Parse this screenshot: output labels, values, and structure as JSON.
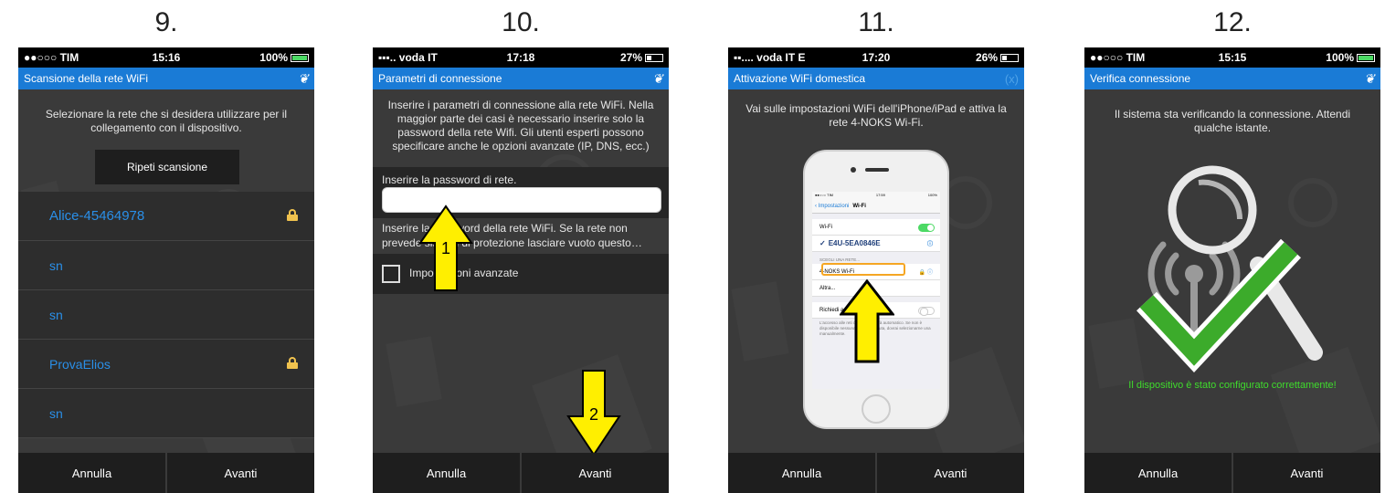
{
  "steps": [
    {
      "number": "9.",
      "status": {
        "carrier": "●●○○○ TIM",
        "time": "15:16",
        "battery": "100%"
      },
      "title": "Scansione della rete WiFi",
      "description": "Selezionare la rete che si desidera utilizzare per il collegamento con il dispositivo.",
      "scan_button": "Ripeti scansione",
      "networks": [
        {
          "ssid": "Alice-45464978",
          "locked": true
        },
        {
          "ssid": "sn",
          "locked": false
        },
        {
          "ssid": "sn",
          "locked": false
        },
        {
          "ssid": "ProvaElios",
          "locked": true
        },
        {
          "ssid": "sn",
          "locked": false
        }
      ],
      "buttons": {
        "cancel": "Annulla",
        "next": "Avanti"
      }
    },
    {
      "number": "10.",
      "status": {
        "carrier": "▪▪▪.. voda IT",
        "time": "17:18",
        "battery": "27%"
      },
      "title": "Parametri di connessione",
      "description": "Inserire i parametri di connessione alla rete WiFi. Nella maggior parte dei casi è necessario inserire solo la password della rete Wifi. Gli utenti esperti possono specificare anche le opzioni avanzate (IP, DNS, ecc.)",
      "password_label": "Inserire la password di rete.",
      "password_value": "",
      "password_help": "Inserire la password della rete WiFi. Se la rete non prevede sistemi di protezione lasciare vuoto questo…",
      "advanced_label": "Impostazioni avanzate",
      "arrow_labels": [
        "1",
        "2"
      ],
      "buttons": {
        "cancel": "Annulla",
        "next": "Avanti"
      }
    },
    {
      "number": "11.",
      "status": {
        "carrier": "▪▪.... voda IT  E",
        "time": "17:20",
        "battery": "26%"
      },
      "title": "Attivazione WiFi domestica",
      "close": "(x)",
      "description": "Vai sulle impostazioni WiFi dell'iPhone/iPad e attiva la rete 4-NOKS Wi-Fi.",
      "ios": {
        "status_left": "●●○○○ TIM",
        "status_time": "17:59",
        "status_right": "100%",
        "back": "‹ Impostazioni",
        "nav_title": "Wi-Fi",
        "wifi_label": "Wi-Fi",
        "connected_network": "E4U-5EA0846E",
        "section_label": "SCEGLI UNA RETE...",
        "highlight_network": "4-NOKS Wi-Fi",
        "other_label": "Altra...",
        "ask_label": "Richiedi accesso reti",
        "footer": "L'accesso alle reti conosciute sarà automatico. Se non è disponibile nessuna rete conosciuta, dovrai selezionarne una manualmente."
      },
      "buttons": {
        "cancel": "Annulla",
        "next": "Avanti"
      }
    },
    {
      "number": "12.",
      "status": {
        "carrier": "●●○○○ TIM",
        "time": "15:15",
        "battery": "100%"
      },
      "title": "Verifica connessione",
      "description": "Il sistema sta verificando la connessione. Attendi qualche istante.",
      "success": "Il dispositivo è stato configurato correttamente!",
      "buttons": {
        "cancel": "Annulla",
        "next": "Avanti"
      }
    }
  ],
  "colors": {
    "titlebar": "#1a7bd6",
    "network_link": "#2a8fe8",
    "lock": "#f0c24e",
    "arrow": "#ffef00",
    "success": "#3fdc2c",
    "check": "#3cab2b"
  }
}
